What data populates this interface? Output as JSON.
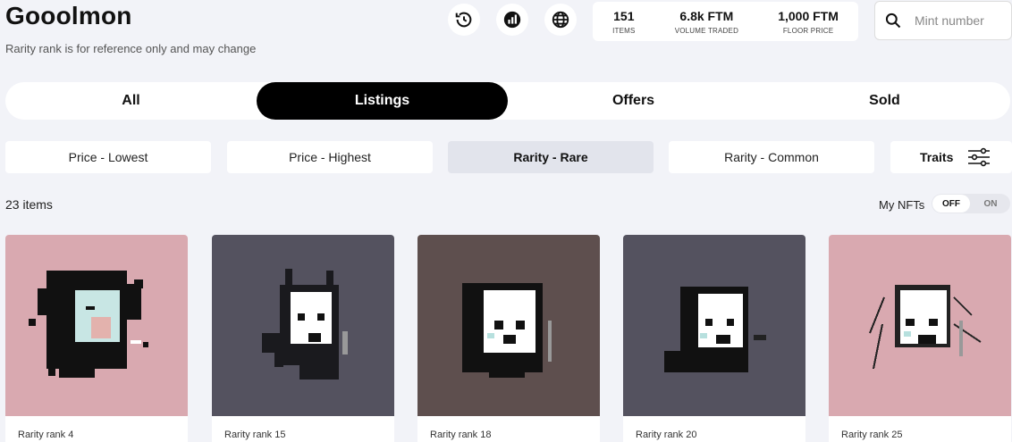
{
  "header": {
    "title": "Gooolmon",
    "subtitle": "Rarity rank is for reference only and may change",
    "icons": [
      "history-icon",
      "chart-icon",
      "globe-icon"
    ]
  },
  "stats": [
    {
      "value": "151",
      "label": "ITEMS"
    },
    {
      "value": "6.8k FTM",
      "label": "VOLUME TRADED"
    },
    {
      "value": "1,000 FTM",
      "label": "FLOOR PRICE"
    }
  ],
  "search": {
    "placeholder": "Mint number",
    "value": ""
  },
  "tabs": [
    {
      "label": "All",
      "active": false
    },
    {
      "label": "Listings",
      "active": true
    },
    {
      "label": "Offers",
      "active": false
    },
    {
      "label": "Sold",
      "active": false
    }
  ],
  "sort": [
    {
      "label": "Price - Lowest",
      "active": false
    },
    {
      "label": "Price - Highest",
      "active": false
    },
    {
      "label": "Rarity - Rare",
      "active": true
    },
    {
      "label": "Rarity - Common",
      "active": false
    }
  ],
  "traits_label": "Traits",
  "count_label": "23 items",
  "my_nfts": {
    "label": "My NFTs",
    "off": "OFF",
    "on": "ON",
    "selected": "OFF"
  },
  "cards": [
    {
      "caption": "Rarity rank 4",
      "bg": "#d9a9b0",
      "face": "#c8e6e4"
    },
    {
      "caption": "Rarity rank 15",
      "bg": "#54525f",
      "face": "#ffffff"
    },
    {
      "caption": "Rarity rank 18",
      "bg": "#5e4f4e",
      "face": "#ffffff"
    },
    {
      "caption": "Rarity rank 20",
      "bg": "#54525f",
      "face": "#ffffff"
    },
    {
      "caption": "Rarity rank 25",
      "bg": "#d9a9b0",
      "face": "#ffffff"
    }
  ],
  "colors": {
    "accent": "#000000",
    "page_bg": "#f2f3f8",
    "active_sort": "#e2e4ec"
  }
}
